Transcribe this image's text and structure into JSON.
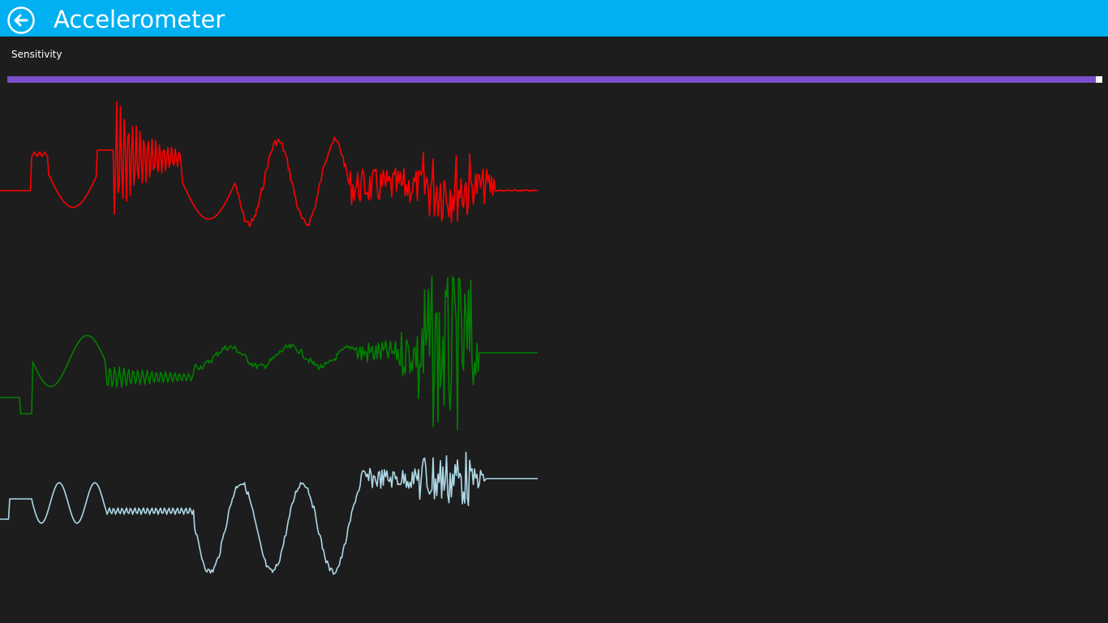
{
  "header": {
    "title": "Accelerometer",
    "back_icon": "back-arrow-icon",
    "background": "#00b0f0"
  },
  "sensitivity": {
    "label": "Sensitivity",
    "value": 1.0,
    "fill_color": "#7b4fcc",
    "thumb_color": "#ffffff"
  },
  "chart_data": {
    "type": "line",
    "grid": false,
    "legend": "none",
    "series": [
      {
        "color": "#ff0000",
        "baseline": 0.0
      },
      {
        "color": "#008000",
        "baseline": 0.0
      },
      {
        "color": "#add8e6",
        "baseline": 0.0
      }
    ]
  }
}
